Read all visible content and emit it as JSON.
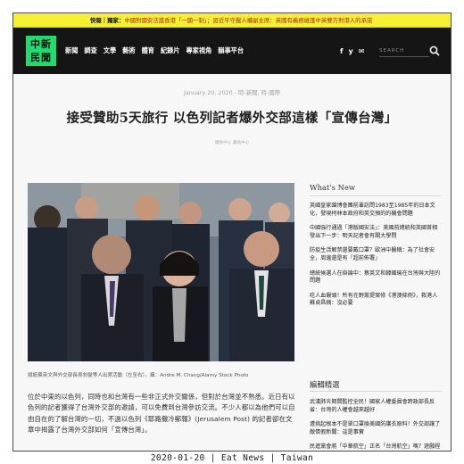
{
  "ticker": {
    "lead": "快報｜獨家：",
    "text": "中國對國安法護香港「一國一制」；習近平守嚴人權副主席：英國有義務維護中英雙方對港人的承諾"
  },
  "brand": {
    "logo_line1": "中新",
    "logo_line2": "民聞"
  },
  "nav": {
    "items": [
      "新聞",
      "調查",
      "文學",
      "藝術",
      "體育",
      "紀錄片",
      "專家視角",
      "韻事平台"
    ]
  },
  "social": {
    "facebook": "f",
    "twitter": "y",
    "email": "✉"
  },
  "search": {
    "placeholder": "SEARCH"
  },
  "article": {
    "meta": "January 20, 2020 - 時-新聞, 時-國際",
    "title": "接受贊助5天旅行 以色列記者爆外交部這樣「宣傳台灣」",
    "byline": "蕭勁中心  蕭勁中心",
    "caption": "總統蔡英文與外交部長吳釗燮等人出席活動（左至右）。攝：Andre M. Chang/Alamy Stock Photo",
    "body": "位於中東的以色列，同時也和台灣有一些非正式外交關係，但對於台灣並不熟悉。近日有以色列的記者獲得了台灣外交部的邀請，可以免費到台灣參訪交流。不少人都以為他們可以自由自在的了解台灣的一切，不過以色列《耶路撒冷郵報》(Jerusalem Post) 的記者卻在文章中揭露了台灣外交部如何「宣傳台灣」。"
  },
  "sidebar": {
    "whats_new_title": "What's New",
    "whats_new": [
      "英國皇家園博會團前輩訪問1983至1985年的日本文化，發現柯林本政府和英交預的的機會問題",
      "中國強行通過「港版國安法」：美國前總統和英國首相發出下一步：明天記者會有關大學問",
      "防疫生活解禁還要戴口罩？歐洲中醫稱：為了社會安全，周邊還是有「超前佈署」",
      "總統候選人在辯論中：蔡英文和韓國瑜在台灣與大陸的問題",
      "吃人血饅頭！所有在野黨提案修《港澳條例》，救港人 蘇貞昌稱：沒必要"
    ],
    "editor_title": "編輯精選",
    "editor_picks": [
      "武漢肺炎期間監控全民！國家人權委員會跨政部長反省：台灣的人權會越來越好",
      "遭挑起根本不是單口罩換美國防護衣原料！外交部讓了敵情假新聞：這是事實",
      "民進黨會將「中華航空」正名「台灣航空」嗎？遊戲程式修：速來選正名都不會！"
    ]
  },
  "footer": {
    "caption": "2020-01-20 | Eat News | Taiwan"
  }
}
